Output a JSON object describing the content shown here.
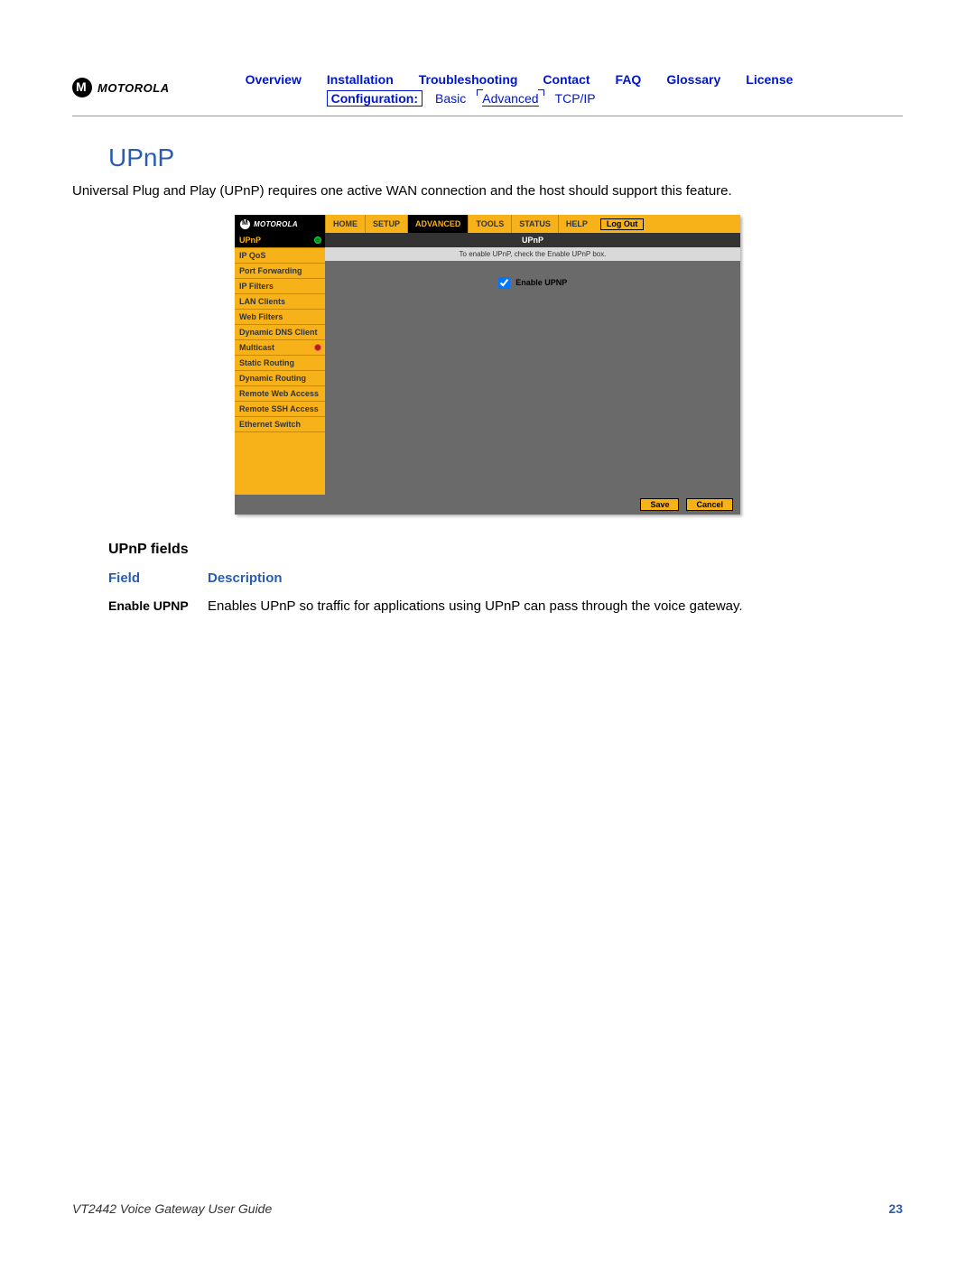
{
  "header": {
    "brand": "MOTOROLA",
    "nav": {
      "overview": "Overview",
      "installation": "Installation",
      "troubleshooting": "Troubleshooting",
      "contact": "Contact",
      "faq": "FAQ",
      "glossary": "Glossary",
      "license": "License"
    },
    "subnav": {
      "configuration": "Configuration:",
      "basic": "Basic",
      "advanced": "Advanced",
      "tcpip": "TCP/IP"
    }
  },
  "section": {
    "title": "UPnP",
    "intro": "Universal Plug and Play (UPnP) requires one active WAN connection and the host should support this feature."
  },
  "router": {
    "brand": "MOTOROLA",
    "tabs": {
      "home": "HOME",
      "setup": "SETUP",
      "advanced": "ADVANCED",
      "tools": "TOOLS",
      "status": "STATUS",
      "help": "HELP"
    },
    "logout": "Log Out",
    "sidebar": [
      "UPnP",
      "IP QoS",
      "Port Forwarding",
      "IP Filters",
      "LAN Clients",
      "Web Filters",
      "Dynamic DNS Client",
      "Multicast",
      "Static Routing",
      "Dynamic Routing",
      "Remote Web Access",
      "Remote SSH Access",
      "Ethernet Switch"
    ],
    "pane": {
      "title": "UPnP",
      "hint": "To enable UPnP, check the Enable UPnP box.",
      "field_label": "Enable UPNP"
    },
    "buttons": {
      "save": "Save",
      "cancel": "Cancel"
    }
  },
  "fields_section": {
    "heading": "UPnP fields",
    "col_field": "Field",
    "col_desc": "Description",
    "rows": [
      {
        "field": "Enable UPNP",
        "desc": "Enables UPnP so traffic for applications using UPnP can pass through the voice gateway."
      }
    ]
  },
  "footer": {
    "doc": "VT2442 Voice Gateway User Guide",
    "page": "23"
  }
}
